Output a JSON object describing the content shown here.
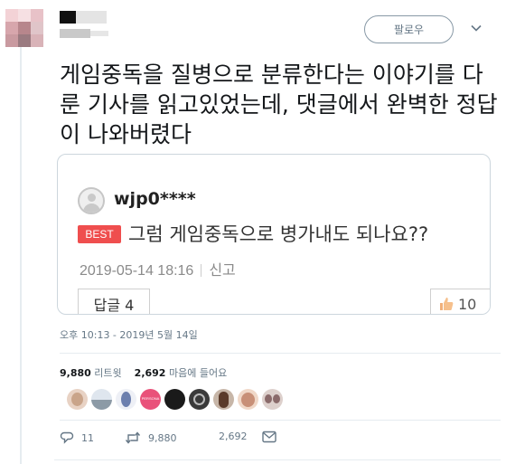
{
  "tweet": {
    "follow_label": "팔로우",
    "text": "게임중독을 질병으로 분류한다는 이야기를 다룬 기사를 읽고있었는데, 댓글에서 완벽한 정답이 나와버렸다",
    "timestamp": "오후 10:13 - 2019년 5월 14일",
    "retweets_count": "9,880",
    "retweets_label": "리트윗",
    "likes_count": "2,692",
    "likes_label": "마음에 들어요"
  },
  "card": {
    "username": "wjp0****",
    "badge": "BEST",
    "comment": "그럼 게임중독으로 병가내도 되나요??",
    "date": "2019-05-14 18:16",
    "report_label": "신고",
    "reply_label": "답글 4",
    "like_label": "10"
  },
  "actions": {
    "replies": "11",
    "retweets": "9,880",
    "likes": "2,692"
  },
  "likers": [
    {
      "name": "liker-1",
      "color": "#c9a48a"
    },
    {
      "name": "liker-2",
      "color": "#a8b8c8"
    },
    {
      "name": "liker-3",
      "color": "#6c7fae"
    },
    {
      "name": "liker-4",
      "color": "#e9527a",
      "text": "PERSONA"
    },
    {
      "name": "liker-5",
      "color": "#1a1a1a"
    },
    {
      "name": "liker-6",
      "color": "#3a3a3a"
    },
    {
      "name": "liker-7",
      "color": "#8a6a5a"
    },
    {
      "name": "liker-8",
      "color": "#c89078"
    },
    {
      "name": "liker-9",
      "color": "#9a8a8a"
    }
  ],
  "colors": {
    "secondary_text": "#657786",
    "border": "#e6ecf0",
    "best_badge": "#ef4e4e"
  }
}
